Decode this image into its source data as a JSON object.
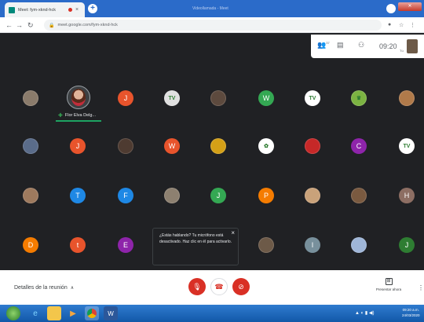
{
  "browser": {
    "tab_title": "Meet: fym-xknd-hck",
    "tab_close": "×",
    "new_tab": "+",
    "window_title": "Videollamada - Meet",
    "url": "meet.google.com/fym-xknd-hck"
  },
  "meet": {
    "info": {
      "participants_count": "37",
      "time": "09:20",
      "self_label": "Tú"
    },
    "speaker": {
      "name": "Flor Elva Delg..."
    },
    "tiles": [
      {
        "kind": "photo",
        "color": "#8a7b6b"
      },
      {
        "kind": "letter",
        "letter": "J",
        "color": "#e8542c"
      },
      {
        "kind": "photo",
        "color": "#e0e0e0",
        "glyph": "TV"
      },
      {
        "kind": "photo",
        "color": "#5d4a3e"
      },
      {
        "kind": "letter",
        "letter": "W",
        "color": "#34a853"
      },
      {
        "kind": "photo",
        "color": "#ffffff",
        "glyph": "TV"
      },
      {
        "kind": "photo",
        "color": "#7cb342",
        "glyph": "♛"
      },
      {
        "kind": "photo",
        "color": "#b07a4a"
      },
      {
        "kind": "photo",
        "color": "#5a6c8a"
      },
      {
        "kind": "letter",
        "letter": "J",
        "color": "#e8542c"
      },
      {
        "kind": "photo",
        "color": "#4e3b31"
      },
      {
        "kind": "letter",
        "letter": "W",
        "color": "#e8542c"
      },
      {
        "kind": "photo",
        "color": "#d4a017"
      },
      {
        "kind": "photo",
        "color": "#ffffff",
        "glyph": "✿"
      },
      {
        "kind": "photo",
        "color": "#c62828"
      },
      {
        "kind": "letter",
        "letter": "C",
        "color": "#8e24aa"
      },
      {
        "kind": "photo",
        "color": "#ffffff",
        "glyph": "TV"
      },
      {
        "kind": "photo",
        "color": "#9e7a5e"
      },
      {
        "kind": "letter",
        "letter": "T",
        "color": "#1e88e5"
      },
      {
        "kind": "letter",
        "letter": "F",
        "color": "#1e88e5"
      },
      {
        "kind": "photo",
        "color": "#8d8070"
      },
      {
        "kind": "letter",
        "letter": "J",
        "color": "#34a853"
      },
      {
        "kind": "letter",
        "letter": "P",
        "color": "#f57c00"
      },
      {
        "kind": "photo",
        "color": "#c9a27a"
      },
      {
        "kind": "photo",
        "color": "#7a5a40"
      },
      {
        "kind": "letter",
        "letter": "H",
        "color": "#8d6e63"
      },
      {
        "kind": "letter",
        "letter": "D",
        "color": "#f57c00"
      },
      {
        "kind": "letter",
        "letter": "t",
        "color": "#e8542c"
      },
      {
        "kind": "letter",
        "letter": "E",
        "color": "#8e24aa"
      },
      {
        "kind": "photo",
        "color": "#6d5a48"
      },
      {
        "kind": "letter",
        "letter": "I",
        "color": "#78909c"
      },
      {
        "kind": "photo",
        "color": "#9fb6d8"
      },
      {
        "kind": "letter",
        "letter": "J",
        "color": "#2e7d32"
      }
    ],
    "toast": {
      "text": "¿Estás hablando? Tu micrófono está desactivado. Haz clic en él para activarlo.",
      "close": "×"
    },
    "controls": {
      "details_label": "Detalles de la reunión",
      "present_label": "Presentar ahora",
      "more": "⋮"
    }
  },
  "taskbar": {
    "clock_time": "09:20 a.m.",
    "clock_date": "24/03/2020"
  },
  "colors": {
    "meet_bg": "#202124",
    "danger": "#d93025",
    "speaker_accent": "#1ea362",
    "taskbar": "#1f6ac0"
  }
}
